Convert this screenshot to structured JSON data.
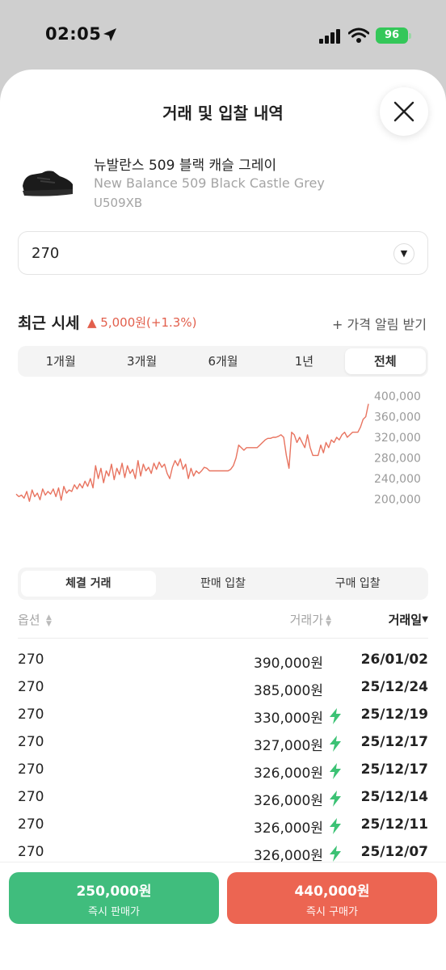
{
  "status": {
    "time": "02:05",
    "battery": "96"
  },
  "header": {
    "title": "거래 및 입찰 내역"
  },
  "product": {
    "name_ko": "뉴발란스 509 블랙 캐슬 그레이",
    "name_en": "New Balance 509 Black Castle Grey",
    "model": "U509XB"
  },
  "size_select": {
    "value": "270"
  },
  "market": {
    "heading": "최근 시세",
    "change": "▲ 5,000원(+1.3%)",
    "alert": "+ 가격 알림 받기"
  },
  "period_tabs": [
    "1개월",
    "3개월",
    "6개월",
    "1년",
    "전체"
  ],
  "active_period": "전체",
  "chart_data": {
    "type": "line",
    "color": "#e8735f",
    "ylim": [
      190000,
      400000
    ],
    "yticks": [
      "400,000",
      "360,000",
      "320,000",
      "280,000",
      "240,000",
      "200,000"
    ],
    "ytick_values": [
      400000,
      360000,
      320000,
      280000,
      240000,
      200000
    ],
    "values": [
      210000,
      205000,
      208000,
      202000,
      215000,
      196000,
      218000,
      205000,
      212000,
      199000,
      220000,
      208000,
      215000,
      210000,
      220000,
      205000,
      222000,
      198000,
      225000,
      212000,
      218000,
      215000,
      228000,
      220000,
      230000,
      222000,
      235000,
      225000,
      240000,
      222000,
      265000,
      240000,
      260000,
      232000,
      255000,
      245000,
      268000,
      238000,
      260000,
      248000,
      270000,
      242000,
      265000,
      250000,
      258000,
      240000,
      275000,
      245000,
      268000,
      255000,
      262000,
      250000,
      270000,
      258000,
      272000,
      262000,
      268000,
      250000,
      240000,
      262000,
      275000,
      265000,
      278000,
      258000,
      268000,
      240000,
      260000,
      245000,
      255000,
      250000,
      255000,
      262000,
      260000,
      255000,
      255000,
      255000,
      255000,
      255000,
      255000,
      255000,
      255000,
      258000,
      265000,
      280000,
      305000,
      300000,
      295000,
      300000,
      300000,
      300000,
      300000,
      300000,
      305000,
      310000,
      315000,
      318000,
      318000,
      320000,
      320000,
      322000,
      325000,
      320000,
      285000,
      260000,
      330000,
      325000,
      310000,
      320000,
      310000,
      300000,
      325000,
      300000,
      285000,
      285000,
      285000,
      305000,
      290000,
      310000,
      300000,
      315000,
      310000,
      320000,
      315000,
      325000,
      330000,
      320000,
      325000,
      330000,
      330000,
      330000,
      340000,
      355000,
      360000,
      385000
    ],
    "title": "",
    "xlabel": "",
    "ylabel": ""
  },
  "trade_tabs": [
    "체결 거래",
    "판매 입찰",
    "구매 입찰"
  ],
  "active_trade_tab": "체결 거래",
  "table": {
    "headers": {
      "option": "옵션",
      "price": "거래가",
      "date": "거래일"
    },
    "rows": [
      {
        "size": "270",
        "price": "390,000원",
        "date": "26/01/02",
        "quick": false
      },
      {
        "size": "270",
        "price": "385,000원",
        "date": "25/12/24",
        "quick": false
      },
      {
        "size": "270",
        "price": "330,000원",
        "date": "25/12/19",
        "quick": true
      },
      {
        "size": "270",
        "price": "327,000원",
        "date": "25/12/17",
        "quick": true
      },
      {
        "size": "270",
        "price": "326,000원",
        "date": "25/12/17",
        "quick": true
      },
      {
        "size": "270",
        "price": "326,000원",
        "date": "25/12/14",
        "quick": true
      },
      {
        "size": "270",
        "price": "326,000원",
        "date": "25/12/11",
        "quick": true
      },
      {
        "size": "270",
        "price": "326,000원",
        "date": "25/12/07",
        "quick": true
      }
    ]
  },
  "actions": {
    "sell_price": "250,000원",
    "sell_label": "즉시 판매가",
    "buy_price": "440,000원",
    "buy_label": "즉시 구매가"
  }
}
